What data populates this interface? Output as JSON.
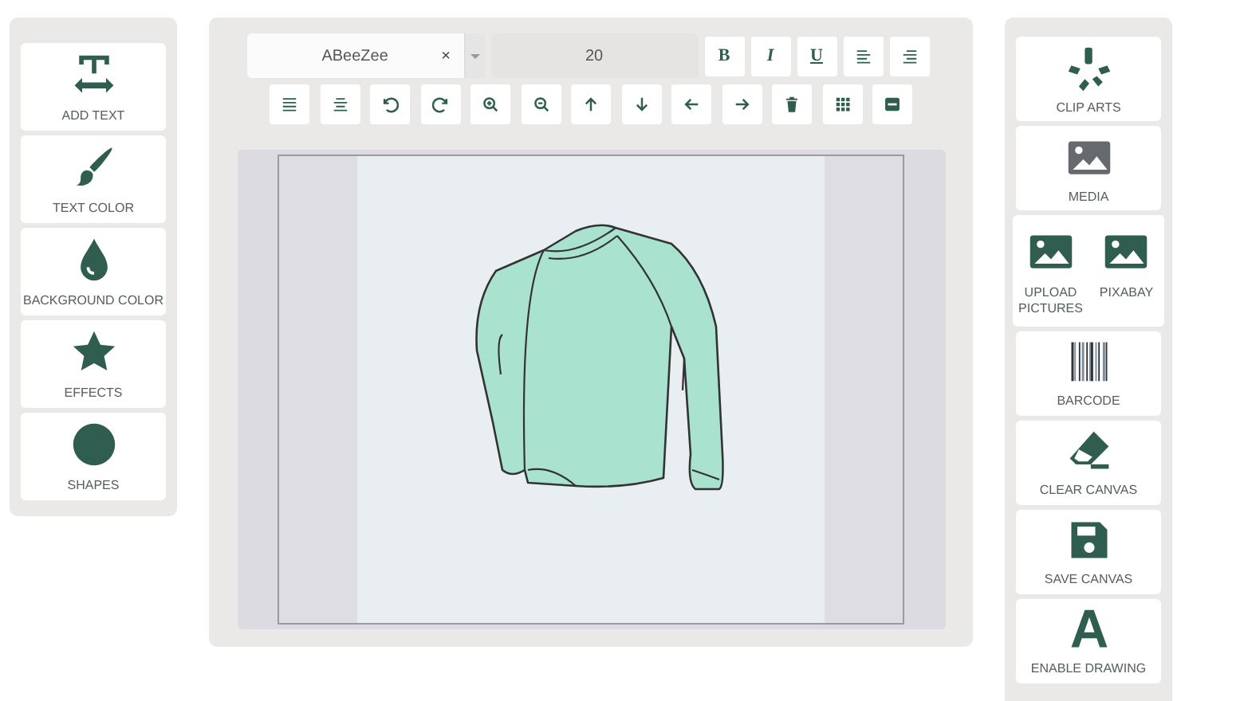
{
  "left_panel": {
    "items": [
      {
        "label": "ADD TEXT"
      },
      {
        "label": "TEXT COLOR"
      },
      {
        "label": "BACKGROUND COLOR"
      },
      {
        "label": "EFFECTS"
      },
      {
        "label": "SHAPES"
      }
    ]
  },
  "toolbar": {
    "font": {
      "value": "ABeeZee",
      "clear": "×"
    },
    "size": {
      "value": "20"
    },
    "format_buttons": [
      "B",
      "I",
      "U"
    ]
  },
  "right_panel": {
    "items": [
      {
        "label": "CLIP ARTS"
      },
      {
        "label": "MEDIA",
        "expanded": true,
        "children": [
          {
            "label": "UPLOAD PICTURES"
          },
          {
            "label": "PIXABAY"
          }
        ]
      },
      {
        "label": "BARCODE"
      },
      {
        "label": "CLEAR CANVAS"
      },
      {
        "label": "SAVE CANVAS"
      },
      {
        "label": "ENABLE DRAWING"
      }
    ]
  }
}
